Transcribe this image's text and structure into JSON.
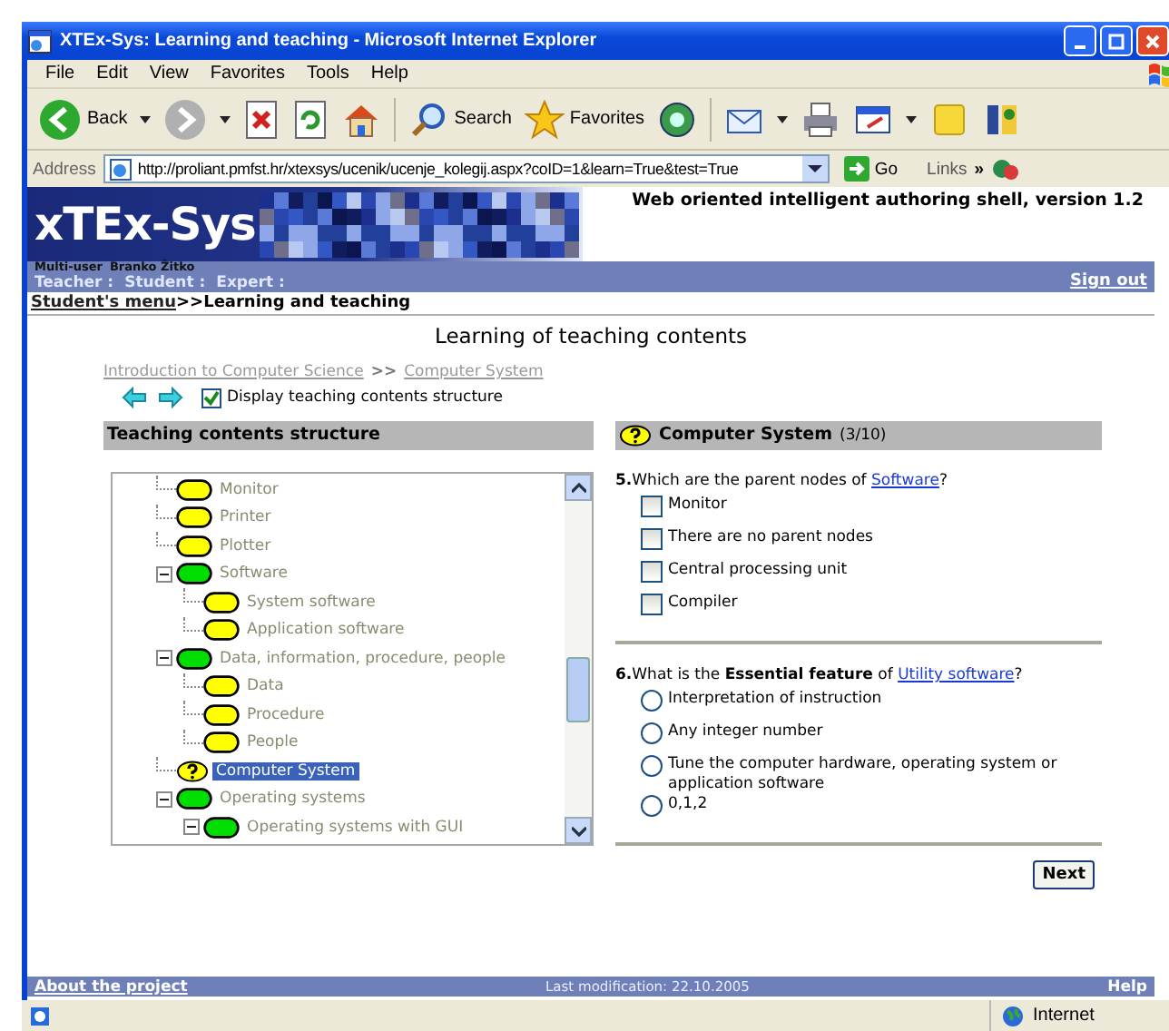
{
  "window": {
    "title": "XTEx-Sys: Learning and teaching - Microsoft Internet Explorer"
  },
  "menu": [
    "File",
    "Edit",
    "View",
    "Favorites",
    "Tools",
    "Help"
  ],
  "toolbar": [
    {
      "kind": "back",
      "label": "Back"
    },
    {
      "kind": "forward"
    },
    {
      "kind": "stop"
    },
    {
      "kind": "refresh"
    },
    {
      "kind": "home"
    },
    {
      "kind": "search",
      "label": "Search"
    },
    {
      "kind": "favorites",
      "label": "Favorites"
    },
    {
      "kind": "media"
    },
    {
      "kind": "mail"
    },
    {
      "kind": "print"
    },
    {
      "kind": "edit"
    },
    {
      "kind": "notes"
    },
    {
      "kind": "messenger"
    }
  ],
  "address": {
    "label": "Address",
    "value": "http://proliant.pmfst.hr/xtexsys/ucenik/ucenje_kolegij.aspx?coID=1&learn=True&test=True",
    "go": "Go",
    "links": "Links",
    "more": "»"
  },
  "site": {
    "logo": "xTEx-Sys",
    "tagline": "Web oriented intelligent authoring shell, version 1.2",
    "user_mode": "Multi-user",
    "user_name": "Branko Žitko",
    "nav": [
      "Teacher :",
      "Student :",
      "Expert :"
    ],
    "sign_out": "Sign out"
  },
  "breadcrumb": {
    "link": "Student's menu",
    "current": ">>Learning and teaching"
  },
  "heading": "Learning of teaching contents",
  "path": {
    "items": [
      "Introduction to Computer Science",
      "Computer System"
    ],
    "separator": ">>"
  },
  "display_structure": {
    "label": "Display teaching contents structure",
    "checked": true
  },
  "structure": {
    "title": "Teaching contents structure",
    "nodes": [
      {
        "label": "Monitor",
        "kind": "concept",
        "selected": false
      },
      {
        "label": "Printer",
        "kind": "concept",
        "selected": false
      },
      {
        "label": "Plotter",
        "kind": "concept",
        "selected": false
      },
      {
        "label": "Software",
        "kind": "group",
        "expanded": true,
        "selected": false,
        "children": [
          {
            "label": "System software",
            "kind": "concept",
            "selected": false
          },
          {
            "label": "Application software",
            "kind": "concept",
            "selected": false
          }
        ]
      },
      {
        "label": "Data, information, procedure, people",
        "kind": "group",
        "expanded": true,
        "selected": false,
        "children": [
          {
            "label": "Data",
            "kind": "concept",
            "selected": false
          },
          {
            "label": "Procedure",
            "kind": "concept",
            "selected": false
          },
          {
            "label": "People",
            "kind": "concept",
            "selected": false
          }
        ]
      },
      {
        "label": "Computer System",
        "kind": "question",
        "selected": true
      },
      {
        "label": "Operating systems",
        "kind": "group",
        "expanded": true,
        "selected": false,
        "children": [
          {
            "label": "Operating systems with GUI",
            "kind": "group",
            "expanded": true,
            "selected": false
          }
        ]
      }
    ]
  },
  "lesson": {
    "title": "Computer System",
    "progress": "(3/10)",
    "next": "Next",
    "questions": [
      {
        "kind": "multiple",
        "text": "**5.**Which are the parent nodes of ",
        "link": "Software",
        "end": "?",
        "options": [
          {
            "label": "Monitor",
            "checked": false
          },
          {
            "label": "There are no parent nodes",
            "checked": false
          },
          {
            "label": "Central processing unit",
            "checked": false
          },
          {
            "label": "Compiler",
            "checked": false
          }
        ]
      },
      {
        "kind": "single",
        "text": "**6.**What is the **Essential feature** of ",
        "link": "Utility software",
        "end": "?",
        "options": [
          {
            "label": "Interpretation of instruction",
            "checked": false
          },
          {
            "label": "Any integer number",
            "checked": false
          },
          {
            "label": "Tune the computer hardware, operating system or application software",
            "checked": false
          },
          {
            "label": "0,1,2",
            "checked": false
          }
        ]
      }
    ]
  },
  "footer": {
    "about": "About the project",
    "modified": "Last modification: 22.10.2005",
    "help": "Help"
  },
  "status_bar": {
    "zone": "Internet"
  }
}
